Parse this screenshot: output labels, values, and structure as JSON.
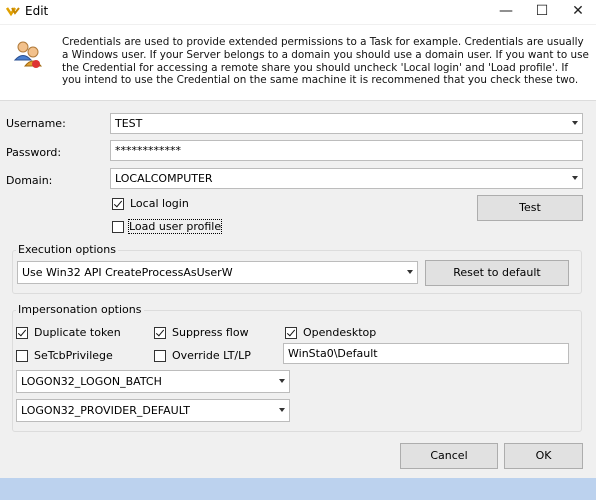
{
  "window": {
    "title": "Edit",
    "minimize": "—",
    "maximize": "☐",
    "close": "✕"
  },
  "info": {
    "text": "Credentials are used to provide extended permissions to a Task for example. Credentials are usually a Windows user. If your Server belongs to a domain you should use a domain user. If you want to use the Credential for accessing a remote share you should uncheck 'Local login' and 'Load profile'. If you intend to use the Credential on the same machine it is recommened that you check these two."
  },
  "form": {
    "username_label": "Username:",
    "username_value": "TEST",
    "password_label": "Password:",
    "password_value": "************",
    "domain_label": "Domain:",
    "domain_value": "LOCALCOMPUTER",
    "local_login_label": "Local login",
    "local_login_checked": true,
    "load_profile_label": "Load user profile",
    "load_profile_checked": false,
    "test_button": "Test"
  },
  "execution": {
    "title": "Execution options",
    "method_value": "Use Win32 API CreateProcessAsUserW",
    "reset_button": "Reset to default"
  },
  "impersonation": {
    "title": "Impersonation options",
    "duplicate_token": "Duplicate token",
    "suppress_flow": "Suppress flow",
    "open_desktop": "Opendesktop",
    "setcb": "SeTcbPrivilege",
    "override": "Override LT/LP",
    "desktop_value": "WinSta0\\Default",
    "logon_type": "LOGON32_LOGON_BATCH",
    "logon_provider": "LOGON32_PROVIDER_DEFAULT"
  },
  "footer": {
    "cancel": "Cancel",
    "ok": "OK"
  },
  "colors": {
    "titlebar": "#ffffff",
    "dialog_bg": "#f0f0f0",
    "bottom_strip": "#bcd2ee"
  },
  "icons": {
    "app": "chevron-logo-icon",
    "info": "users-icon"
  }
}
